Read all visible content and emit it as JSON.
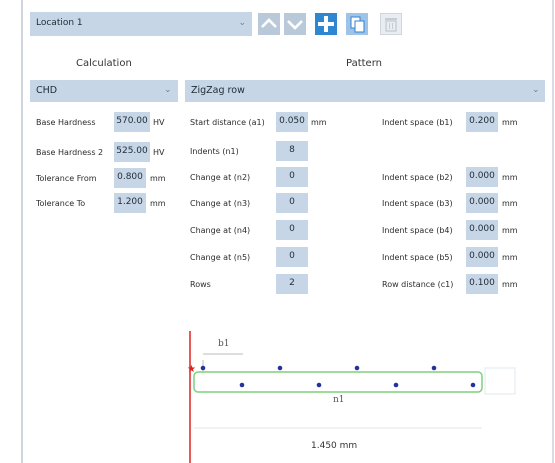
{
  "toolbar": {
    "location": "Location 1",
    "buttons": [
      "move-up",
      "move-down",
      "add",
      "copy",
      "delete"
    ]
  },
  "headers": {
    "calculation": "Calculation",
    "pattern": "Pattern"
  },
  "calculation": {
    "method": "CHD",
    "fields": [
      {
        "label": "Base Hardness",
        "value": "570.00",
        "unit": "HV"
      },
      {
        "label": "Base Hardness 2",
        "value": "525.00",
        "unit": "HV"
      },
      {
        "label": "Tolerance From",
        "value": "0.800",
        "unit": "mm"
      },
      {
        "label": "Tolerance To",
        "value": "1.200",
        "unit": "mm"
      }
    ]
  },
  "pattern": {
    "type": "ZigZag row",
    "left_fields": [
      {
        "label": "Start distance (a1)",
        "value": "0.050",
        "unit": "mm"
      },
      {
        "label": "Indents (n1)",
        "value": "8",
        "unit": ""
      },
      {
        "label": "Change at (n2)",
        "value": "0",
        "unit": ""
      },
      {
        "label": "Change at (n3)",
        "value": "0",
        "unit": ""
      },
      {
        "label": "Change at (n4)",
        "value": "0",
        "unit": ""
      },
      {
        "label": "Change at (n5)",
        "value": "0",
        "unit": ""
      },
      {
        "label": "Rows",
        "value": "2",
        "unit": ""
      }
    ],
    "right_fields": [
      {
        "label": "Indent space (b1)",
        "value": "0.200",
        "unit": "mm"
      },
      {
        "label": "Indent space (b2)",
        "value": "0.000",
        "unit": "mm"
      },
      {
        "label": "Indent space (b3)",
        "value": "0.000",
        "unit": "mm"
      },
      {
        "label": "Indent space (b4)",
        "value": "0.000",
        "unit": "mm"
      },
      {
        "label": "Indent space (b5)",
        "value": "0.000",
        "unit": "mm"
      },
      {
        "label": "Row distance (c1)",
        "value": "0.100",
        "unit": "mm"
      }
    ]
  },
  "diagram": {
    "b_label": "b1",
    "n_label": "n1",
    "length": "1.450 mm"
  },
  "colors": {
    "field_bg": "#c7d6e6",
    "accent": "#2f86d1",
    "dot": "#2233a0",
    "row_box": "#7fd07f",
    "ref_line": "#e02020"
  }
}
